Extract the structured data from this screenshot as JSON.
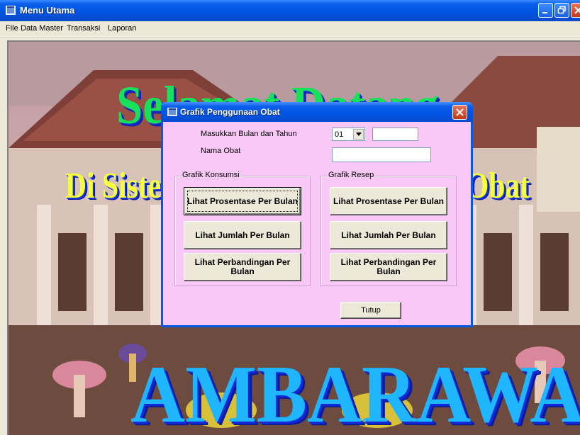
{
  "main_window": {
    "title": "Menu Utama",
    "menu": [
      "File",
      "Data Master",
      "Transaksi",
      "Laporan"
    ]
  },
  "background": {
    "line1": "Selamat Datang",
    "line2_left": "Di Sistem",
    "line2_right": "Obat",
    "line3": "AMBARAWA"
  },
  "dialog": {
    "title": "Grafik Penggunaan Obat",
    "label_bulan_tahun": "Masukkan Bulan dan Tahun",
    "month_value": "01",
    "year_value": "",
    "label_nama_obat": "Nama Obat",
    "nama_obat_value": "",
    "group_konsumsi": {
      "title": "Grafik Konsumsi",
      "buttons": [
        "Lihat Prosentase Per Bulan",
        "Lihat Jumlah Per Bulan",
        "Lihat Perbandingan Per Bulan"
      ]
    },
    "group_resep": {
      "title": "Grafik Resep",
      "buttons": [
        "Lihat Prosentase Per Bulan",
        "Lihat Jumlah Per Bulan",
        "Lihat Perbandingan Per Bulan"
      ]
    },
    "close_label": "Tutup"
  },
  "colors": {
    "dialog_body": "#f9c8f7",
    "titlebar": "#0054e3",
    "button_face": "#ece9d8"
  },
  "icons": [
    "app-icon",
    "minimize-icon",
    "maximize-icon",
    "close-icon",
    "dropdown-arrow-icon"
  ]
}
